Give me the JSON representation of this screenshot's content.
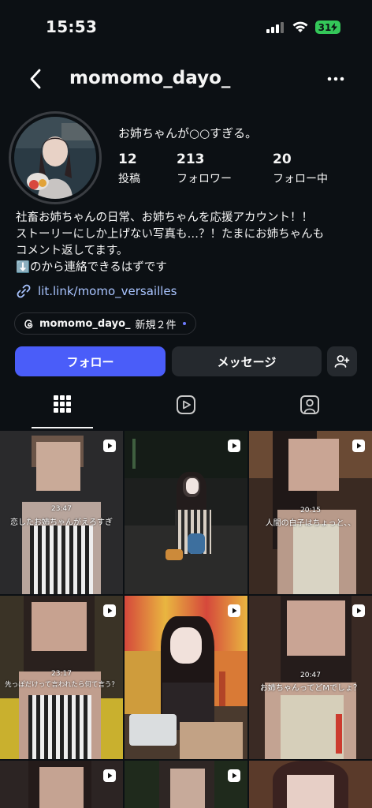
{
  "status_bar": {
    "time": "15:53",
    "battery": "31"
  },
  "header": {
    "username": "momomo_dayo_"
  },
  "profile": {
    "display_name": "お姉ちゃんが○○すぎる。",
    "stats": [
      {
        "value": "12",
        "label": "投稿"
      },
      {
        "value": "213",
        "label": "フォロワー"
      },
      {
        "value": "20",
        "label": "フォロー中"
      }
    ],
    "bio_lines": [
      "社畜お姉ちゃんの日常、お姉ちゃんを応援アカウント！！",
      "ストーリーにしか上げない写真も…？！たまにお姉ちゃんも",
      "コメント返してます。",
      "⬇️のから連絡できるはずです"
    ],
    "link": "lit.link/momo_versailles",
    "threads_chip": {
      "handle": "momomo_dayo_",
      "badge": "新規２件"
    }
  },
  "actions": {
    "follow": "フォロー",
    "message": "メッセージ"
  },
  "tabs": [
    {
      "name": "posts-grid",
      "icon": "grid-icon",
      "active": true
    },
    {
      "name": "reels",
      "icon": "reels-icon",
      "active": false
    },
    {
      "name": "tagged",
      "icon": "tagged-icon",
      "active": false
    }
  ],
  "grid": [
    {
      "time": "23:47",
      "caption": "恋したお姉ちゃんがえろすぎ",
      "reel": true
    },
    {
      "time": "",
      "caption": "",
      "reel": true
    },
    {
      "time": "20:15",
      "caption": "人間の白子はちょっと、、",
      "reel": true
    },
    {
      "time": "23:17",
      "caption": "先っぽだけって言われたら何て言う？",
      "reel": true
    },
    {
      "time": "",
      "caption": "",
      "reel": true
    },
    {
      "time": "20:47",
      "caption": "お姉ちゃんってどMでしょ？",
      "reel": true
    },
    {
      "time": "",
      "caption": "",
      "reel": true
    },
    {
      "time": "",
      "caption": "",
      "reel": true
    },
    {
      "time": "",
      "caption": "",
      "reel": false
    }
  ],
  "colors": {
    "background": "#0c1014",
    "follow_button": "#4a5df9",
    "secondary_button": "#25292e",
    "link": "#a9c4ff",
    "battery": "#34c759"
  }
}
